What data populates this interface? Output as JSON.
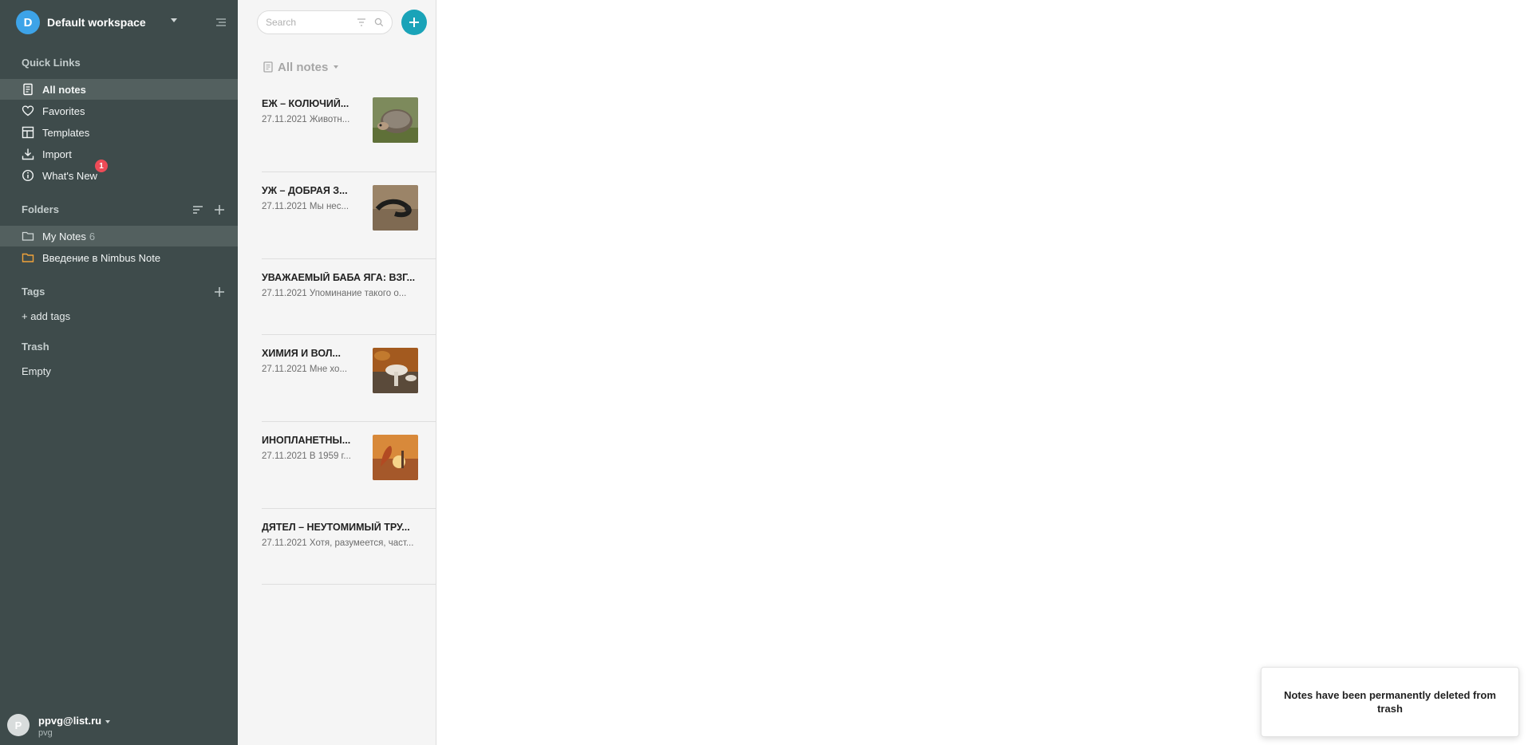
{
  "workspace": {
    "avatar_letter": "D",
    "name": "Default workspace"
  },
  "quick_links": {
    "title": "Quick Links",
    "items": [
      {
        "label": "All notes",
        "icon": "notes-icon"
      },
      {
        "label": "Favorites",
        "icon": "heart-icon"
      },
      {
        "label": "Templates",
        "icon": "templates-icon"
      },
      {
        "label": "Import",
        "icon": "import-icon"
      },
      {
        "label": "What's New",
        "icon": "info-icon",
        "badge": "1"
      }
    ]
  },
  "folders": {
    "title": "Folders",
    "items": [
      {
        "label": "My Notes",
        "count": "6",
        "color": "#cfd6d6"
      },
      {
        "label": "Введение в Nimbus Note",
        "count": "",
        "color": "#f0a33a"
      }
    ]
  },
  "tags": {
    "title": "Tags",
    "add_label": "+ add tags"
  },
  "trash": {
    "title": "Trash",
    "status": "Empty"
  },
  "user": {
    "avatar_letter": "P",
    "email": "ppvg@list.ru",
    "name": "pvg"
  },
  "search": {
    "placeholder": "Search"
  },
  "notes_list": {
    "title": "All notes",
    "notes": [
      {
        "title": "ЕЖ – КОЛЮЧИЙ...",
        "date": "27.11.2021",
        "snippet": "Животн...",
        "thumb": "hedgehog"
      },
      {
        "title": "УЖ – ДОБРАЯ З...",
        "date": "27.11.2021",
        "snippet": "Мы нес...",
        "thumb": "snake"
      },
      {
        "title": "УВАЖАЕМЫЙ БАБА ЯГА: ВЗГ...",
        "date": "27.11.2021",
        "snippet": "Упоминание такого о...",
        "thumb": ""
      },
      {
        "title": "ХИМИЯ И ВОЛ...",
        "date": "27.11.2021",
        "snippet": "Мне хо...",
        "thumb": "mushrooms"
      },
      {
        "title": "ИНОПЛАНЕТНЫ...",
        "date": "27.11.2021",
        "snippet": "В 1959 г...",
        "thumb": "alien-sunset"
      },
      {
        "title": "ДЯТЕЛ – НЕУТОМИМЫЙ ТРУ...",
        "date": "27.11.2021",
        "snippet": "Хотя, разумеется, част...",
        "thumb": ""
      }
    ]
  },
  "toast": {
    "message": "Notes have been permanently deleted from trash"
  },
  "colors": {
    "sidebar_bg": "#3e4b4b",
    "accent": "#1aa3b8",
    "badge": "#ee4b57",
    "workspace_avatar": "#3da3e8"
  }
}
